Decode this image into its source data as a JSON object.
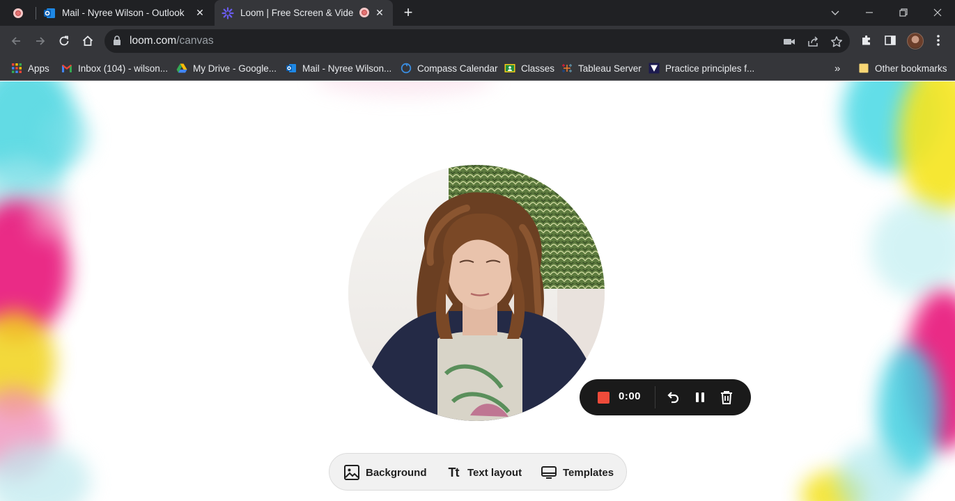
{
  "tabs": [
    {
      "title": "",
      "icon": "recording-dot-icon"
    },
    {
      "title": "Mail - Nyree Wilson - Outlook",
      "icon": "outlook-icon"
    },
    {
      "title": "Loom | Free Screen & Video",
      "icon": "loom-icon",
      "active": true
    }
  ],
  "omnibox": {
    "domain": "loom.com",
    "path": "/canvas"
  },
  "bookmarks": [
    {
      "label": "Apps",
      "icon": "apps-grid-icon"
    },
    {
      "label": "Inbox (104) - wilson...",
      "icon": "gmail-icon"
    },
    {
      "label": "My Drive - Google...",
      "icon": "google-drive-icon"
    },
    {
      "label": "Mail - Nyree Wilson...",
      "icon": "outlook-icon"
    },
    {
      "label": "Compass Calendar",
      "icon": "compass-icon"
    },
    {
      "label": "Classes",
      "icon": "classroom-icon"
    },
    {
      "label": "Tableau Server",
      "icon": "tableau-icon"
    },
    {
      "label": "Practice principles f...",
      "icon": "practice-principles-icon"
    },
    {
      "label": "Other bookmarks",
      "icon": "folder-icon"
    }
  ],
  "recording": {
    "timer": "0:00"
  },
  "bottom_bar": {
    "background": "Background",
    "text_layout": "Text layout",
    "templates": "Templates"
  },
  "colors": {
    "accent_stop": "#ef4b3a",
    "chrome_dark": "#202124",
    "chrome_toolbar": "#35363a",
    "splash_pink": "#e8157a",
    "splash_cyan": "#3ad3e0",
    "splash_yellow": "#f4e21c"
  }
}
